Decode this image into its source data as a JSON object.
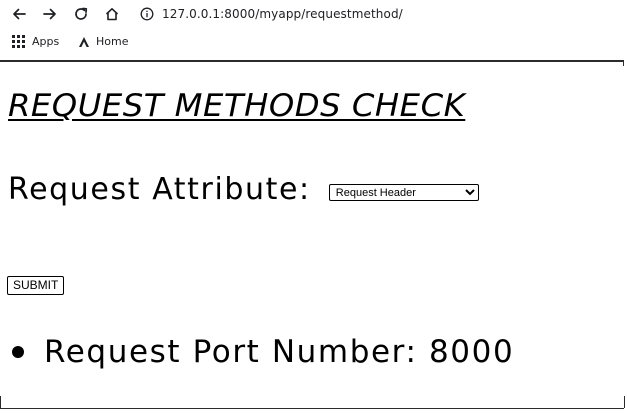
{
  "browser": {
    "url": "127.0.0.1:8000/myapp/requestmethod/",
    "icons": {
      "back": "back-arrow-icon",
      "forward": "forward-arrow-icon",
      "reload": "reload-icon",
      "home": "home-icon",
      "info": "info-icon"
    }
  },
  "bookmarks": {
    "apps_label": "Apps",
    "home_label": "Home"
  },
  "page": {
    "title": "REQUEST METHODS CHECK",
    "attribute_label": "Request Attribute:",
    "select_value": "Request Header",
    "submit_label": "SUBMIT",
    "results": [
      "Request Port Number: 8000"
    ]
  }
}
